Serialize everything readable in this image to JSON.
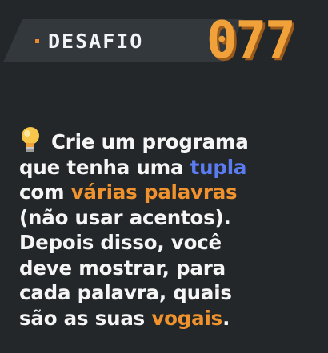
{
  "banner": {
    "label": "DESAFIO",
    "number": "077"
  },
  "colors": {
    "background": "#232729",
    "banner_bar": "#33383d",
    "accent_orange": "#f0932e",
    "accent_blue": "#5a7cf0",
    "text": "#f5f5f5"
  },
  "description": {
    "icon": "lightbulb-icon",
    "line1": "Crie um programa",
    "line2_prefix": "que tenha uma ",
    "line2_highlight": "tupla",
    "line3_prefix": "com ",
    "line3_highlight": "várias palavras",
    "line4": "(não usar acentos).",
    "line5": "Depois disso, você",
    "line6": "deve mostrar, para",
    "line7": "cada palavra, quais",
    "line8_prefix": "são as suas ",
    "line8_highlight": "vogais",
    "line8_suffix": "."
  }
}
